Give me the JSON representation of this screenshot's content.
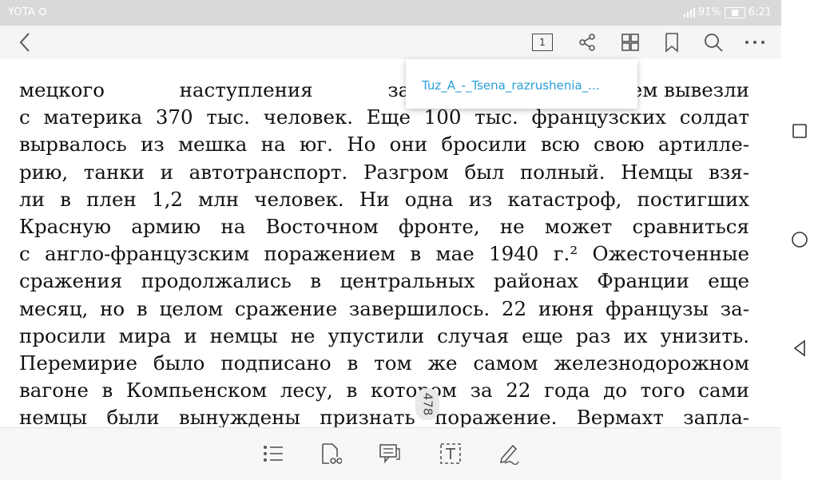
{
  "status": {
    "carrier": "YOTA",
    "signal_battery": "91%",
    "time": "6:21"
  },
  "toolbar": {
    "page_indicator": "1"
  },
  "popup": {
    "filename": "Tuz_A_-_Tsena_razrushenia_..."
  },
  "document": {
    "lines": [
      "мецкого наступления за две неде",
      "с материка 370 тыс. человек. Еще 100 тыс. французских солдат",
      "вырвалось из мешка на юг. Но они бросили всю свою артилле-",
      "рию, танки и автотранспорт. Разгром был полный. Немцы взя-",
      "ли в плен 1,2 млн человек. Ни одна из катастроф, постигших",
      "Красную армию на Восточном фронте, не может сравниться",
      "с англо-французским поражением в мае 1940 г.² Ожесточенные",
      "сражения продолжались в центральных районах Франции еще",
      "месяц, но в целом сражение завершилось. 22 июня французы за-",
      "просили мира и немцы не упустили случая еще раз их унизить.",
      "Перемирие было подписано в том же самом железнодорожном",
      "вагоне в Компьенском лесу, в котором за 22 года до того сами",
      "немцы были вынуждены признать поражение. Вермахт запла-"
    ],
    "page_number": "478",
    "first_line_tail": "м вывезли"
  },
  "icons": {
    "back": "back-arrow-icon",
    "share": "share-icon",
    "grid": "grid-icon",
    "bookmark": "bookmark-icon",
    "search": "search-icon",
    "more": "more-icon",
    "list": "list-icon",
    "document": "document-icon",
    "comment": "comment-icon",
    "text": "text-icon",
    "pen": "pen-icon"
  },
  "colors": {
    "link": "#2a9ed8",
    "statusbar": "#d9d9d9"
  }
}
